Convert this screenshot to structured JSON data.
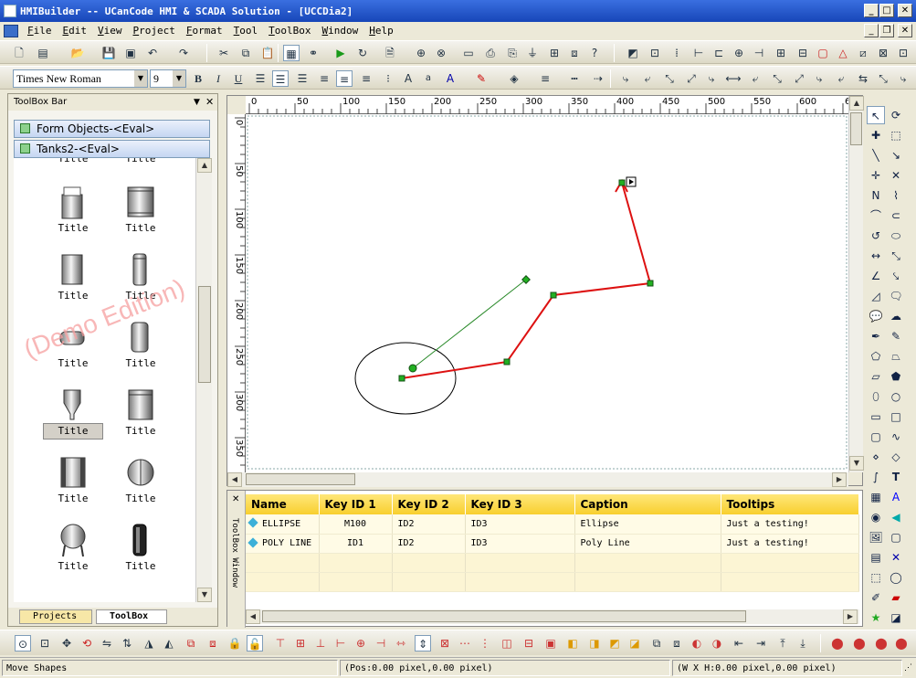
{
  "window": {
    "title": "HMIBuilder -- UCanCode HMI & SCADA Solution - [UCCDia2]"
  },
  "menu": [
    "File",
    "Edit",
    "View",
    "Project",
    "Format",
    "Tool",
    "ToolBox",
    "Window",
    "Help"
  ],
  "format": {
    "font_name": "Times New Roman",
    "font_size": "9"
  },
  "toolbox": {
    "header": "ToolBox Bar",
    "categories": [
      "Form Objects-<Eval>",
      "Tanks2-<Eval>"
    ],
    "item_label": "Title",
    "watermark": "(Demo Edition)",
    "tabs": [
      "Projects",
      "ToolBox"
    ]
  },
  "ruler": {
    "top": [
      "0",
      "50",
      "100",
      "150",
      "200",
      "250",
      "300",
      "350",
      "400",
      "450",
      "500",
      "550",
      "600",
      "6"
    ],
    "left": [
      "0",
      "50",
      "100",
      "150",
      "200",
      "250",
      "300",
      "350"
    ]
  },
  "grid": {
    "side_label": "ToolBox Window",
    "columns": [
      "Name",
      "Key ID 1",
      "Key ID 2",
      "Key ID 3",
      "Caption",
      "Tooltips"
    ],
    "rows": [
      {
        "name": "ELLIPSE",
        "key1": "M100",
        "key2": "ID2",
        "key3": "ID3",
        "caption": "Ellipse",
        "tooltip": "Just a testing!"
      },
      {
        "name": "POLY LINE",
        "key1": "ID1",
        "key2": "ID2",
        "key3": "ID3",
        "caption": "Poly Line",
        "tooltip": "Just a testing!"
      }
    ]
  },
  "status": {
    "mode": "Move Shapes",
    "pos": "(Pos:0.00 pixel,0.00 pixel)",
    "size": "(W X H:0.00 pixel,0.00 pixel)"
  },
  "colors": {
    "polyline": "#dd1111",
    "handle": "#2aa52a",
    "title_bar": "#1f52c8",
    "grid_header": "#f8cf2e"
  }
}
